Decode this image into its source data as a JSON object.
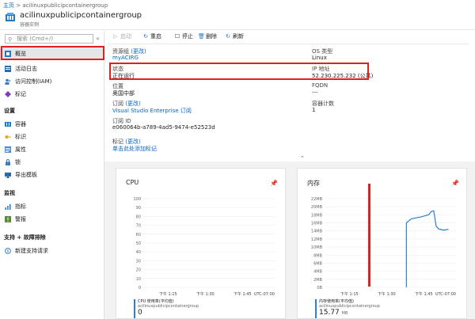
{
  "breadcrumb": {
    "home": "主页",
    "separator": ">",
    "current": "acilinuxpublicipcontainergroup"
  },
  "resource": {
    "title": "acilinuxpublicipcontainergroup",
    "subtitle": "容器实例",
    "icon": "container-instance-icon"
  },
  "search": {
    "placeholder": "搜索 (Cmd+/)",
    "collapse": "«"
  },
  "sidebar": {
    "top_items": [
      {
        "label": "概览",
        "icon": "overview-cloud-icon"
      },
      {
        "label": "活动日志",
        "icon": "activity-log-icon"
      },
      {
        "label": "访问控制(IAM)",
        "icon": "iam-people-icon"
      },
      {
        "label": "标记",
        "icon": "tag-icon"
      }
    ],
    "settings_header": "设置",
    "settings_items": [
      {
        "label": "容器",
        "icon": "containers-icon"
      },
      {
        "label": "标识",
        "icon": "identity-key-icon"
      },
      {
        "label": "属性",
        "icon": "properties-icon"
      },
      {
        "label": "锁",
        "icon": "lock-icon"
      },
      {
        "label": "导出模板",
        "icon": "export-template-icon"
      }
    ],
    "monitoring_header": "监视",
    "monitoring_items": [
      {
        "label": "指标",
        "icon": "metrics-icon"
      },
      {
        "label": "警报",
        "icon": "alerts-icon"
      }
    ],
    "support_header": "支持 + 故障排除",
    "support_items": [
      {
        "label": "新建支持请求",
        "icon": "support-request-icon"
      }
    ]
  },
  "toolbar": {
    "start": "启动",
    "restart": "重启",
    "stop": "停止",
    "delete": "删除",
    "refresh": "刷新"
  },
  "properties": {
    "resource_group_label": "资源组",
    "change": "(更改)",
    "resource_group_value": "myACIRG",
    "os_type_label": "OS 类型",
    "os_type_value": "Linux",
    "status_label": "状态",
    "status_value": "正在运行",
    "ip_label": "IP 地址",
    "ip_value": "52.230.225.232 (公共)",
    "location_label": "位置",
    "location_value": "奥国中部",
    "fqdn_label": "FQDN",
    "fqdn_value": "---",
    "subscription_label": "订阅",
    "subscription_value": "Visual Studio Enterprise 订阅",
    "container_count_label": "容器计数",
    "container_count_value": "1",
    "subscription_id_label": "订阅 ID",
    "subscription_id_value": "e060064b-a789-4ad5-9474-e52523d",
    "tags_label": "标记",
    "tags_value": "单击此处添加标记",
    "expand": "⌃"
  },
  "pin_icon": "pin-icon",
  "accent_color": "#2b7fd6",
  "highlight_color": "#e02020",
  "chart_data": [
    {
      "type": "line",
      "title": "CPU",
      "yticks": [
        0,
        10,
        20,
        30,
        40,
        50,
        60,
        70,
        80,
        90,
        100
      ],
      "ylim": [
        0,
        100
      ],
      "xticks": [
        "下午 1:15",
        "下午 1:30",
        "下午 1:45",
        "UTC-07:00"
      ],
      "series": [],
      "legend": {
        "line1": "CPU 使用率(平均值)",
        "line2": "acilinuxpublicipcontainergroup",
        "value": "0",
        "unit": ""
      }
    },
    {
      "type": "line",
      "title": "内存",
      "yticks": [
        "0B",
        "2MB",
        "4MB",
        "6MB",
        "8MB",
        "10MB",
        "12MB",
        "14MB",
        "16MB",
        "18MB",
        "20MB",
        "22MB"
      ],
      "ylim": [
        0,
        22
      ],
      "xticks": [
        "下午 1:15",
        "下午 1:30",
        "下午 1:45",
        "UTC-07:00"
      ],
      "x": [
        "13:38",
        "13:38",
        "13:40",
        "13:44",
        "13:47",
        "13:48",
        "13:49",
        "13:50",
        "13:51",
        "13:53",
        "13:55"
      ],
      "series": [
        {
          "values": [
            0,
            16,
            17,
            17.5,
            18,
            18.8,
            19,
            15.2,
            14.5,
            14.2,
            14.4
          ]
        }
      ],
      "legend": {
        "line1": "内存使用率(平均值)",
        "line2": "acilinuxpublicipcontainergroup",
        "value": "15.77",
        "unit": "MB"
      }
    }
  ]
}
